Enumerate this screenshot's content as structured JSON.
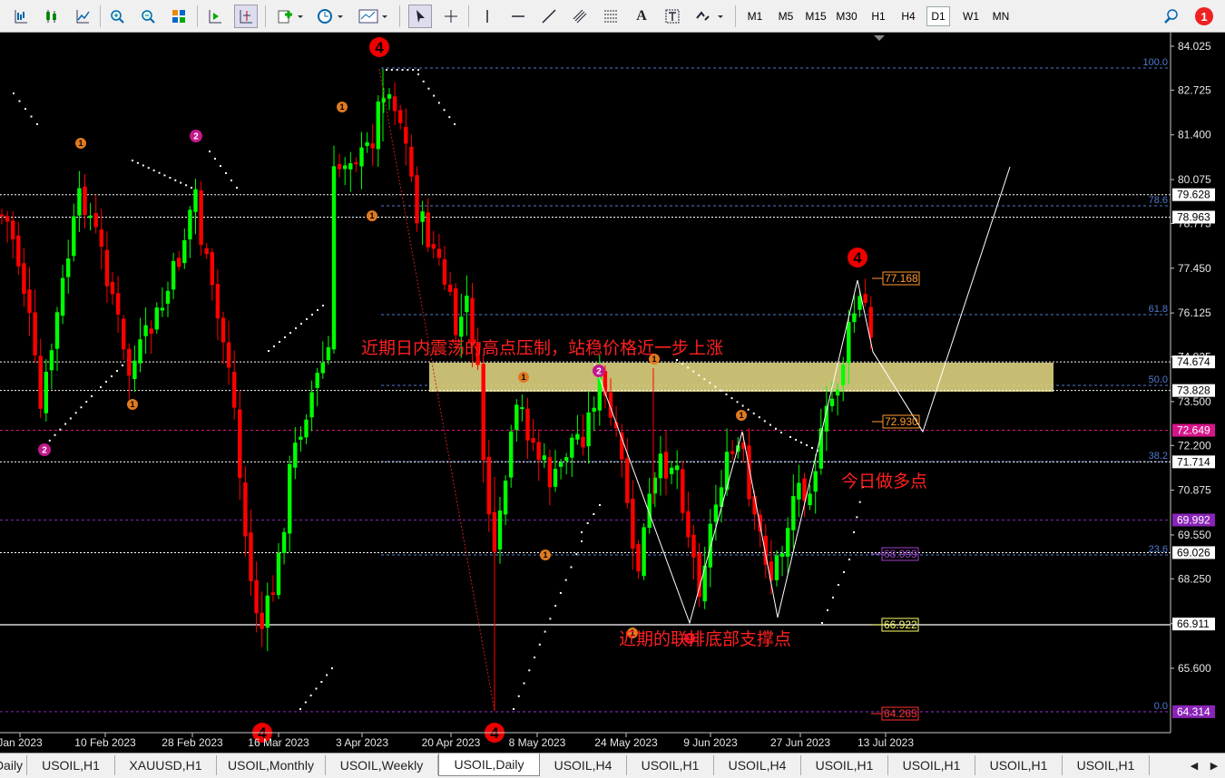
{
  "toolbar": {
    "timeframes": [
      "M1",
      "M5",
      "M15",
      "M30",
      "H1",
      "H4",
      "D1",
      "W1",
      "MN"
    ],
    "active_timeframe": "D1",
    "notification_count": "1"
  },
  "price_axis": {
    "ticks": [
      "84.025",
      "82.725",
      "81.400",
      "80.075",
      "78.775",
      "77.450",
      "76.125",
      "74.825",
      "73.500",
      "72.200",
      "70.875",
      "69.550",
      "68.250",
      "66.925",
      "65.600"
    ],
    "tag_labels": [
      {
        "text": "79.628",
        "style": "white"
      },
      {
        "text": "78.963",
        "style": "white"
      },
      {
        "text": "74.674",
        "style": "white"
      },
      {
        "text": "73.828",
        "style": "white"
      },
      {
        "text": "72.649",
        "style": "magenta"
      },
      {
        "text": "71.714",
        "style": "white"
      },
      {
        "text": "69.992",
        "style": "purple"
      },
      {
        "text": "69.026",
        "style": "white"
      },
      {
        "text": "66.911",
        "style": "white"
      },
      {
        "text": "64.314",
        "style": "purple"
      }
    ]
  },
  "fib_labels": [
    "100.0",
    "78.6",
    "61.8",
    "50.0",
    "38.2",
    "23.6",
    "0.0"
  ],
  "chart_labels": [
    {
      "text": "77.168",
      "color": "orange"
    },
    {
      "text": "72.930",
      "color": "orange"
    },
    {
      "text": "68.999",
      "color": "purple"
    },
    {
      "text": "66.922",
      "color": "yellow"
    },
    {
      "text": "64.265",
      "color": "red"
    }
  ],
  "time_axis": [
    "Jan 2023",
    "10 Feb 2023",
    "28 Feb 2023",
    "16 Mar 2023",
    "3 Apr 2023",
    "20 Apr 2023",
    "8 May 2023",
    "24 May 2023",
    "9 Jun 2023",
    "27 Jun 2023",
    "13 Jul 2023"
  ],
  "annotations": {
    "resistance": "近期日内震荡的高点压制，站稳价格近一步上涨",
    "long_entry": "今日做多点",
    "support": "近期的联排底部支撑点"
  },
  "wave_markers": [
    {
      "text": "4",
      "kind": "red-large"
    },
    {
      "text": "4",
      "kind": "red-large"
    },
    {
      "text": "4",
      "kind": "red-large"
    },
    {
      "text": "4",
      "kind": "red-large"
    },
    {
      "text": "2",
      "kind": "magenta"
    },
    {
      "text": "2",
      "kind": "magenta"
    },
    {
      "text": "2",
      "kind": "magenta"
    },
    {
      "text": "1",
      "kind": "orange"
    },
    {
      "text": "1",
      "kind": "orange"
    },
    {
      "text": "1",
      "kind": "orange"
    },
    {
      "text": "1",
      "kind": "orange"
    },
    {
      "text": "1",
      "kind": "orange"
    },
    {
      "text": "1",
      "kind": "orange"
    },
    {
      "text": "1",
      "kind": "orange"
    },
    {
      "text": "1",
      "kind": "orange"
    },
    {
      "text": "1",
      "kind": "orange"
    },
    {
      "text": "1",
      "kind": "red"
    }
  ],
  "tabs": [
    "Daily",
    "USOIL,H1",
    "XAUUSD,H1",
    "USOIL,Monthly",
    "USOIL,Weekly",
    "USOIL,Daily",
    "USOIL,H4",
    "USOIL,H1",
    "USOIL,H4",
    "USOIL,H1",
    "USOIL,H1",
    "USOIL,H1",
    "USOIL,H1"
  ],
  "active_tab": "USOIL,Daily",
  "colors": {
    "background": "#000000",
    "bull_candle": "#00ff00",
    "bear_candle": "#ff0000",
    "zone": "#d8cd7c",
    "fib": "#4f7bd1",
    "annotation_text": "#ff2020"
  }
}
